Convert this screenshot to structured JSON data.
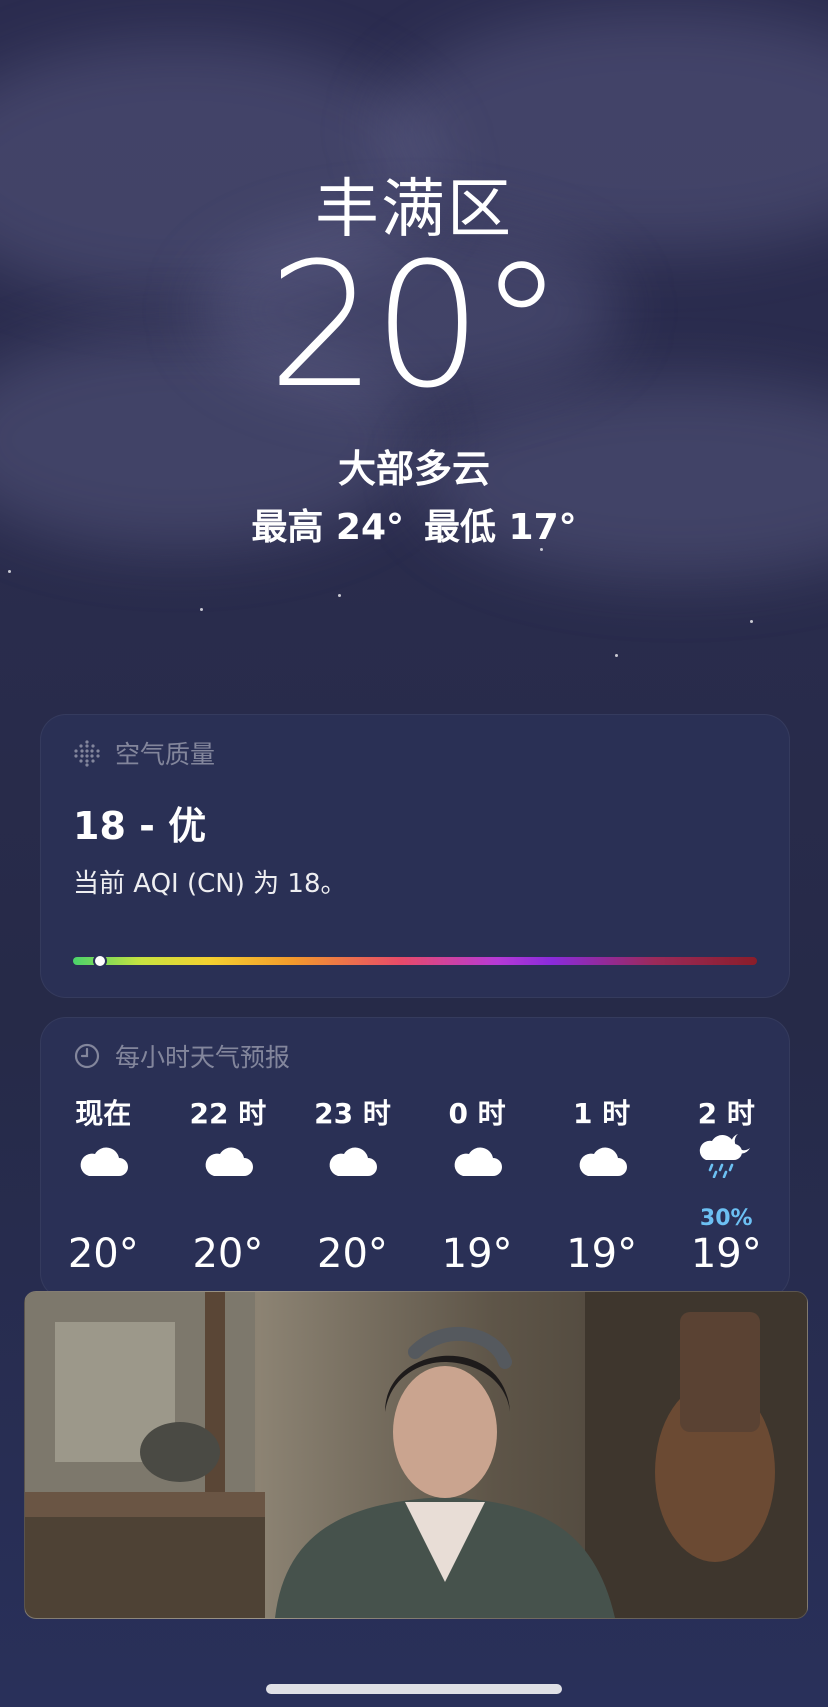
{
  "location": {
    "city": "丰满区",
    "temperature": "20°",
    "condition": "大部多云",
    "high": "最高 24°",
    "low": "最低 17°"
  },
  "air_quality": {
    "title": "空气质量",
    "icon": "air-quality-dots-icon",
    "value_label": "18 - 优",
    "description": "当前 AQI (CN) 为 18。",
    "index": 18,
    "scale_fraction": 0.04
  },
  "hourly_forecast": {
    "title": "每小时天气预报",
    "icon": "clock-icon",
    "hours": [
      {
        "label": "现在",
        "icon": "cloud-icon",
        "temp": "20°",
        "precip": ""
      },
      {
        "label": "22 时",
        "icon": "cloud-icon",
        "temp": "20°",
        "precip": ""
      },
      {
        "label": "23 时",
        "icon": "cloud-icon",
        "temp": "20°",
        "precip": ""
      },
      {
        "label": "0 时",
        "icon": "cloud-icon",
        "temp": "19°",
        "precip": ""
      },
      {
        "label": "1 时",
        "icon": "cloud-icon",
        "temp": "19°",
        "precip": ""
      },
      {
        "label": "2 时",
        "icon": "moon-cloud-rain-icon",
        "temp": "19°",
        "precip": "30%"
      }
    ]
  },
  "colors": {
    "precip_accent": "#6cc0f3",
    "card_bg": "#2c3258"
  }
}
